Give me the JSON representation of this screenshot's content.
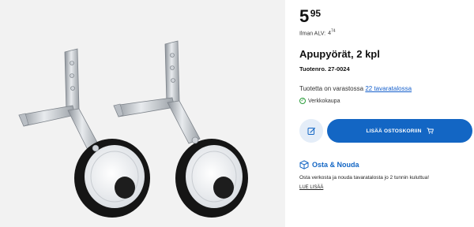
{
  "product_image": {
    "alt": "",
    "icon": "training-wheels-image"
  },
  "price": {
    "integer": "5",
    "decimals": "95"
  },
  "vat": {
    "label": "Ilman ALV:",
    "integer": "4",
    "decimals": "74"
  },
  "product": {
    "title": "Apupyörät, 2 kpl",
    "sku": "Tuotenro. 27-0024"
  },
  "availability": {
    "text": "Tuotetta on varastossa",
    "link_text": "22 tavaratalossa",
    "online_text": "Verkkokaupa",
    "online_icon": "check-circle-icon",
    "online_color": "#2a9d3a"
  },
  "actions": {
    "wishlist_icon": "edit-list-icon",
    "add_to_cart_label": "LISÄÄ OSTOSKORIIN",
    "cart_icon": "cart-icon",
    "primary_color": "#1366c4"
  },
  "pickup": {
    "icon": "box-icon",
    "title": "Osta & Nouda",
    "description": "Osta verkosta ja nouda tavaratalosta jo 2 tunnin kuluttua!",
    "read_more": "LUE LISÄÄ"
  }
}
